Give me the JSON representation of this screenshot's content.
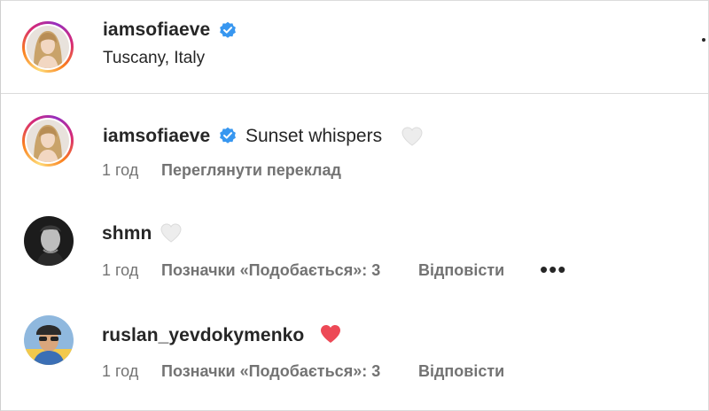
{
  "header": {
    "username": "iamsofiaeve",
    "location": "Tuscany, Italy"
  },
  "comments": [
    {
      "username": "iamsofiaeve",
      "text": "Sunset whispers",
      "time": "1 год",
      "action": "Переглянути переклад",
      "heart": "outline-gray"
    },
    {
      "username": "shmn",
      "text": "",
      "time": "1 год",
      "likes": "Позначки «Подобається»: 3",
      "reply": "Відповісти",
      "more": "•••",
      "heart": "outline-gray"
    },
    {
      "username": "ruslan_yevdokymenko",
      "text": "",
      "time": "1 год",
      "likes": "Позначки «Подобається»: 3",
      "reply": "Відповісти",
      "heart": "filled-red"
    }
  ],
  "colors": {
    "verified": "#3897f0",
    "heart_red": "#ed4956",
    "heart_gray": "#dbdbdb",
    "meta": "#737373",
    "text": "#262626"
  },
  "icons": {
    "verified": "verified-badge-icon",
    "heart": "heart-icon",
    "more": "more-options-icon"
  }
}
